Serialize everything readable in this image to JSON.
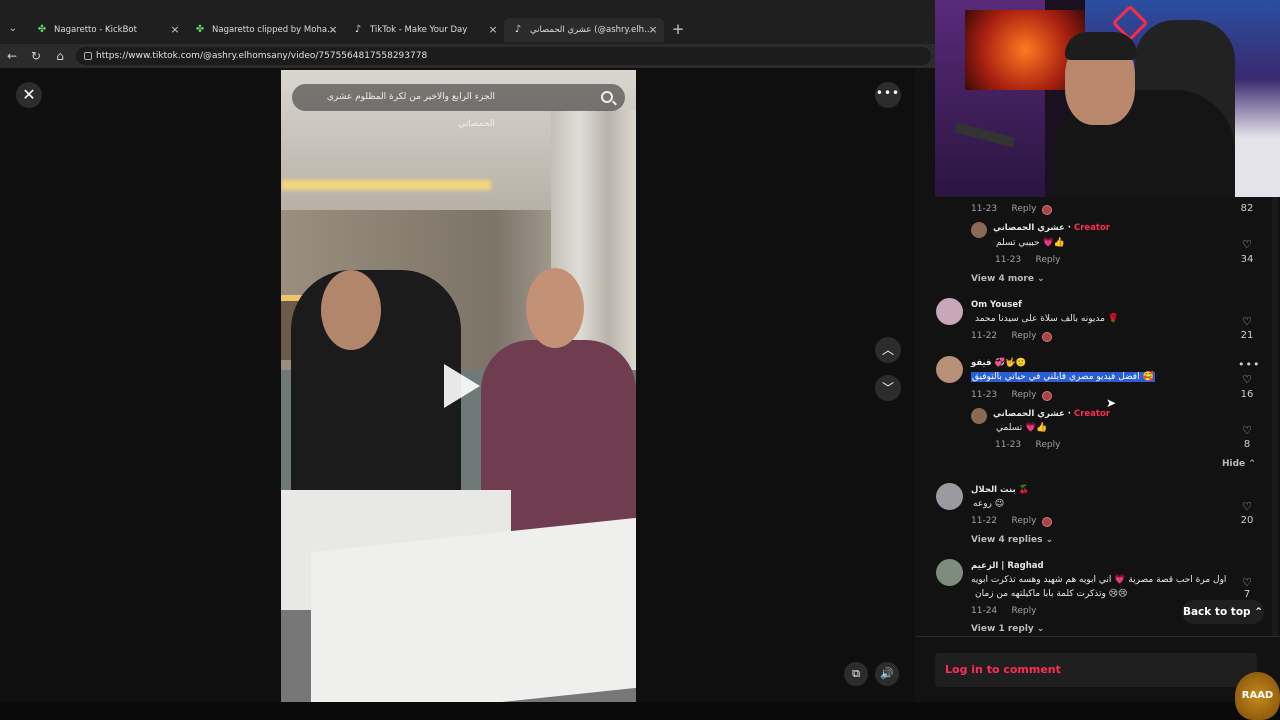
{
  "browser": {
    "tabs": [
      {
        "label": "Nagaretto - KickBot",
        "icon": "clover-icon"
      },
      {
        "label": "Nagaretto clipped by Mohamad_S",
        "icon": "clover-icon"
      },
      {
        "label": "TikTok - Make Your Day",
        "icon": "tiktok-icon"
      },
      {
        "label": "عشري الحمصاني (@ashry.elhomsany)",
        "icon": "tiktok-icon"
      }
    ],
    "url": "https://www.tiktok.com/@ashry.elhomsany/video/7575564817558293778"
  },
  "video": {
    "search_placeholder": "الجزء الرابع والاخير من لكرة المظلوم عشري الحمصاني"
  },
  "comments": {
    "top_meta": {
      "date": "11-23",
      "reply": "Reply",
      "likes": "82"
    },
    "creator_reply_1": {
      "name": "عشري الحمصاني",
      "badge": "Creator",
      "sep": "·",
      "text": "حبيبي تسلم 💗👍",
      "date": "11-23",
      "reply": "Reply",
      "likes": "34"
    },
    "view_more_1": "View 4 more",
    "c2": {
      "name": "Om Yousef",
      "text": "مديونه بالف سلاة على سيدنا محمد 🌹",
      "date": "11-22",
      "reply": "Reply",
      "likes": "21"
    },
    "c3": {
      "name": "فيفو 💞🤟🙂",
      "text": "افضل فيديو مصري قابلني في حياتي بالتوفيق 🥰",
      "date": "11-23",
      "reply": "Reply",
      "likes": "16"
    },
    "creator_reply_2": {
      "name": "عشري الحمصاني",
      "badge": "Creator",
      "sep": "·",
      "text": "تسلمي 💗👍",
      "date": "11-23",
      "reply": "Reply",
      "likes": "8"
    },
    "hide": "Hide",
    "c4": {
      "name": "بنت الحلال 🍒",
      "text": "روعه 😉",
      "date": "11-22",
      "reply": "Reply",
      "likes": "20"
    },
    "view_replies_4": "View 4 replies",
    "c5": {
      "name": "الزعيم | Raghad",
      "text_line1": "اول مرة احب قصة مصرية 💗 اني ابويه هم شهيد وهسه تذكرت ابويه",
      "text_line2": "وتذكرت كلمة بابا ماكيلتهه من زمان 😢😢",
      "date": "11-24",
      "reply": "Reply",
      "likes": "7"
    },
    "view_reply_5": "View 1 reply"
  },
  "back_to_top": "Back to top",
  "login_comment": "Log in to comment",
  "corner_logo": "RAAD"
}
